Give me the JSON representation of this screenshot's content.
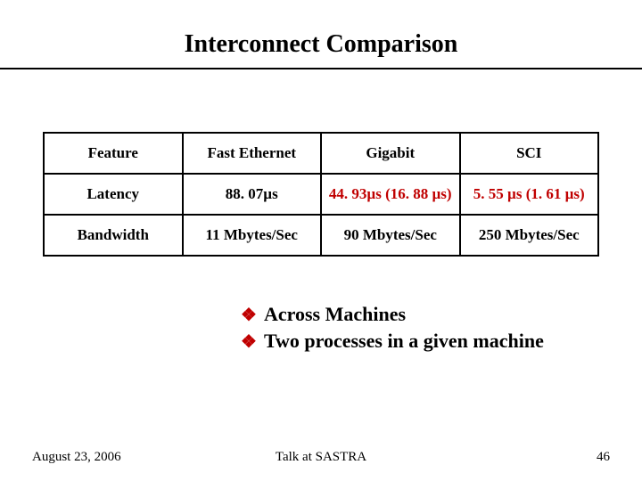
{
  "title": "Interconnect Comparison",
  "table": {
    "headers": [
      "Feature",
      "Fast Ethernet",
      "Gigabit",
      "SCI"
    ],
    "rows": [
      {
        "cells": [
          {
            "text": "Latency",
            "red": false
          },
          {
            "text": "88. 07µs",
            "red": false
          },
          {
            "text": "44. 93µs (16. 88 µs)",
            "red": true
          },
          {
            "text": "5. 55 µs (1. 61 µs)",
            "red": true
          }
        ]
      },
      {
        "cells": [
          {
            "text": "Bandwidth",
            "red": false
          },
          {
            "text": "11 Mbytes/Sec",
            "red": false
          },
          {
            "text": "90 Mbytes/Sec",
            "red": false
          },
          {
            "text": "250 Mbytes/Sec",
            "red": false
          }
        ]
      }
    ]
  },
  "bullets": [
    "Across Machines",
    "Two processes in a given machine"
  ],
  "footer": {
    "date": "August 23, 2006",
    "talk": "Talk at SASTRA",
    "page": "46"
  },
  "chart_data": {
    "type": "table",
    "title": "Interconnect Comparison",
    "columns": [
      "Feature",
      "Fast Ethernet",
      "Gigabit",
      "SCI"
    ],
    "rows": [
      [
        "Latency",
        "88.07µs",
        "44.93µs (16.88 µs)",
        "5.55 µs (1.61 µs)"
      ],
      [
        "Bandwidth",
        "11 Mbytes/Sec",
        "90 Mbytes/Sec",
        "250 Mbytes/Sec"
      ]
    ]
  }
}
